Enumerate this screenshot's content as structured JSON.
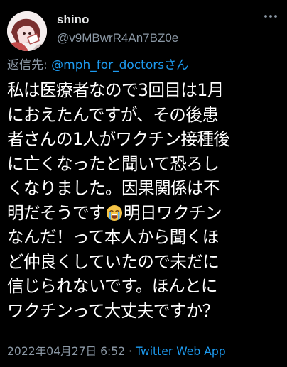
{
  "author": {
    "display_name": "shino",
    "handle": "@v9MBwrR4An7BZ0e",
    "avatar_icon": "anime-character-avatar"
  },
  "more_icon": "more-options-icon",
  "reply": {
    "prefix": "返信先:",
    "mention": "@mph_for_doctors",
    "suffix": "さん"
  },
  "tweet": {
    "lines": [
      "私は医療者なので3回目は1月",
      "におえたんですが、その後患",
      "者さんの1人がワクチン接種後",
      "に亡くなったと聞いて恐ろし",
      "くなりました。因果関係は不",
      "明だそうです",
      "明日ワクチン",
      "なんだ！って本人から聞くほ",
      "ど仲良くしていたので未だに",
      "信じられないです。ほんとに",
      "ワクチンって大丈夫ですか？"
    ],
    "emoji": "loudly-crying-face-emoji"
  },
  "meta": {
    "datetime": "2022年04月27日 6:52",
    "separator": " · ",
    "source": "Twitter Web App"
  },
  "colors": {
    "background": "#000000",
    "text": "#ffffff",
    "secondary": "#8b98a5",
    "link": "#1d9bf0"
  }
}
